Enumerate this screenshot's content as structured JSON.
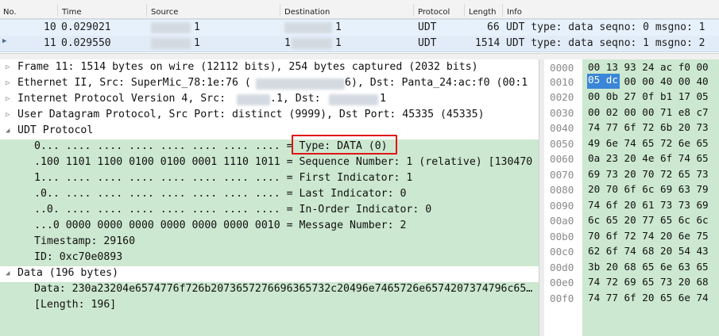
{
  "packet_list": {
    "columns": [
      {
        "key": "no",
        "label": "No."
      },
      {
        "key": "time",
        "label": "Time"
      },
      {
        "key": "source",
        "label": "Source"
      },
      {
        "key": "destination",
        "label": "Destination"
      },
      {
        "key": "protocol",
        "label": "Protocol"
      },
      {
        "key": "length",
        "label": "Length"
      },
      {
        "key": "info",
        "label": "Info"
      }
    ],
    "rows": [
      {
        "no": "10",
        "time": "0.029021",
        "source_tail": "1",
        "destination_tail": "1",
        "protocol": "UDT",
        "length": "66",
        "info": "UDT type: data seqno: 0 msgno: 1"
      },
      {
        "no": "11",
        "time": "0.029550",
        "source_tail": "1",
        "destination_prefix": "1",
        "destination_tail": "1",
        "protocol": "UDT",
        "length": "1514",
        "info": "UDT type: data seqno: 1 msgno: 2"
      }
    ]
  },
  "details": {
    "frame": "Frame 11: 1514 bytes on wire (12112 bits), 254 bytes captured (2032 bits)",
    "ethernet_a": "Ethernet II, Src: SuperMic_78:1e:76 (",
    "ethernet_b": "6), Dst: Panta_24:ac:f0 (00:1",
    "ip_a": "Internet Protocol Version 4, Src:",
    "ip_b": ".1, Dst:",
    "ip_c": "1",
    "udp": "User Datagram Protocol, Src Port: distinct (9999), Dst Port: 45335 (45335)",
    "udt": "UDT Protocol",
    "udt_fields": [
      "0... .... .... .... .... .... .... .... = Type: DATA (0)",
      ".100 1101 1100 0100 0100 0001 1110 1011 = Sequence Number: 1 (relative) [130470",
      "1... .... .... .... .... .... .... .... = First Indicator: 1",
      ".0.. .... .... .... .... .... .... .... = Last Indicator: 0",
      "..0. .... .... .... .... .... .... .... = In-Order Indicator: 0",
      "...0 0000 0000 0000 0000 0000 0000 0010 = Message Number: 2",
      "Timestamp: 29160",
      "ID: 0xc70e0893"
    ],
    "data_header": "Data (196 bytes)",
    "data_value": "Data: 230a23204e6574776f726b2073657276696365732c20496e7465726e6574207374796c65…",
    "data_length": "[Length: 196]"
  },
  "hex": {
    "offsets": [
      "0000",
      "0010",
      "0020",
      "0030",
      "0040",
      "0050",
      "0060",
      "0070",
      "0080",
      "0090",
      "00a0",
      "00b0",
      "00c0",
      "00d0",
      "00e0",
      "00f0"
    ],
    "bytes": [
      "00 13 93 24 ac f0 00",
      "      00 00 40 00 40",
      "00 0b 27 0f b1 17 05",
      "00 02 00 00 71 e8 c7",
      "74 77 6f 72 6b 20 73",
      "49 6e 74 65 72 6e 65",
      "0a 23 20 4e 6f 74 65",
      "69 73 20 70 72 65 73",
      "20 70 6f 6c 69 63 79",
      "74 6f 20 61 73 73 69",
      "6c 65 20 77 65 6c 6c",
      "70 6f 72 74 20 6e 75",
      "62 6f 74 68 20 54 43",
      "3b 20 68 65 6e 63 65",
      "74 72 69 65 73 20 68",
      "74 77 6f 20 65 6e 74"
    ],
    "selected_bytes": "05 dc"
  },
  "colors": {
    "green": "#cce8d0",
    "selection": "#3a86d8",
    "highlight_border": "#e01515"
  }
}
